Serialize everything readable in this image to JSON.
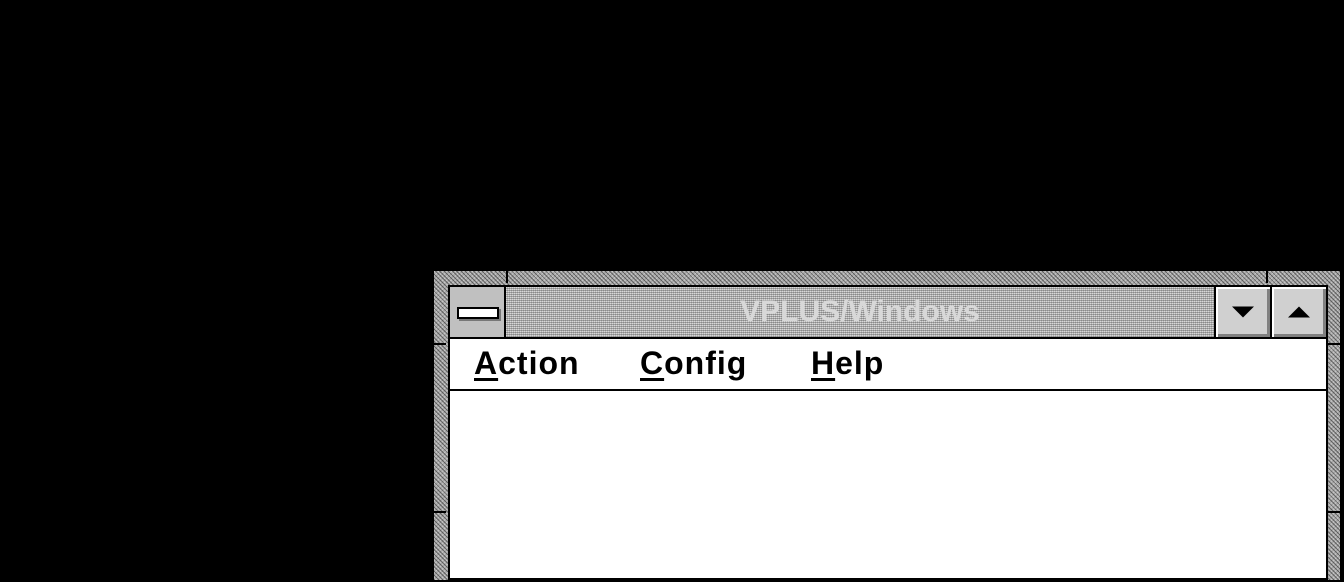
{
  "window": {
    "title": "VPLUS/Windows",
    "system_menu_icon": "system-menu-icon",
    "minimize_icon": "triangle-down-icon",
    "maximize_icon": "triangle-up-icon"
  },
  "menubar": {
    "items": [
      {
        "accel": "A",
        "rest": "ction"
      },
      {
        "accel": "C",
        "rest": "onfig"
      },
      {
        "accel": "H",
        "rest": "elp"
      }
    ]
  },
  "colors": {
    "desktop": "#000000",
    "frame": "#a8a8a8",
    "client": "#ffffff"
  }
}
